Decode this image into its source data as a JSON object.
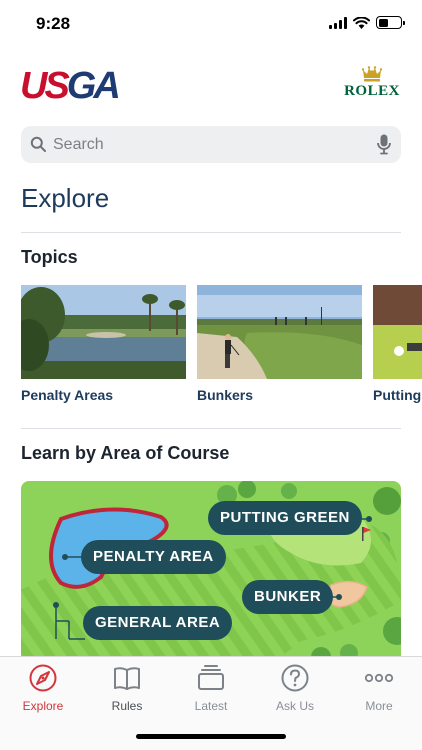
{
  "status": {
    "time": "9:28"
  },
  "brand": {
    "logo_left_1": "US",
    "logo_left_2": "GA",
    "logo_right": "ROLEX"
  },
  "search": {
    "placeholder": "Search",
    "icon": "search-icon",
    "mic_icon": "microphone-icon"
  },
  "page": {
    "title": "Explore"
  },
  "topics": {
    "title": "Topics",
    "items": [
      {
        "label": "Penalty Areas"
      },
      {
        "label": "Bunkers"
      },
      {
        "label": "Putting"
      }
    ]
  },
  "course": {
    "title": "Learn by Area of Course",
    "areas": {
      "putting_green": "PUTTING GREEN",
      "penalty_area": "PENALTY AREA",
      "bunker": "BUNKER",
      "general_area": "GENERAL AREA"
    }
  },
  "tabbar": {
    "items": [
      {
        "label": "Explore",
        "icon": "compass-icon",
        "active": true
      },
      {
        "label": "Rules",
        "icon": "book-icon",
        "active": false
      },
      {
        "label": "Latest",
        "icon": "stack-icon",
        "active": false
      },
      {
        "label": "Ask Us",
        "icon": "question-icon",
        "active": false
      },
      {
        "label": "More",
        "icon": "more-dots-icon",
        "active": false
      }
    ]
  },
  "colors": {
    "accent_red": "#d1373c",
    "navy": "#1f3b5c",
    "pill": "#1f4e5a",
    "rolex_green": "#006039"
  }
}
